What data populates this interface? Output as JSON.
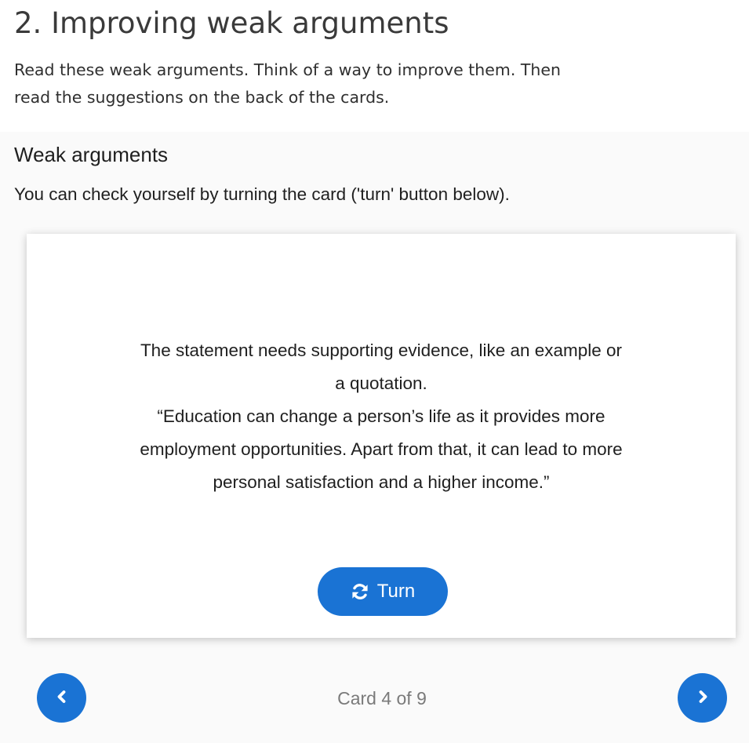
{
  "page": {
    "title": "2. Improving weak arguments",
    "intro_lines": [
      "Read these weak arguments. Think of a way to improve them. Then",
      "read the suggestions on the back of the cards."
    ]
  },
  "activity": {
    "heading": "Weak arguments",
    "description": "You can check yourself by turning the card ('turn' button below).",
    "card": {
      "text_lines": [
        "The statement needs supporting evidence, like an example or",
        "a quotation.",
        "“Education can change a person’s life as it provides more",
        "employment opportunities. Apart from that, it can lead to more",
        "personal satisfaction and a higher income.”"
      ],
      "turn_label": "Turn",
      "turn_icon": "refresh-icon"
    },
    "navigation": {
      "counter": "Card 4 of 9",
      "prev_icon": "chevron-left-icon",
      "next_icon": "chevron-right-icon"
    }
  },
  "colors": {
    "accent": "#1a73d4",
    "panel_background": "#fafafa",
    "card_background": "#ffffff",
    "counter_text": "#7a7a7a"
  }
}
